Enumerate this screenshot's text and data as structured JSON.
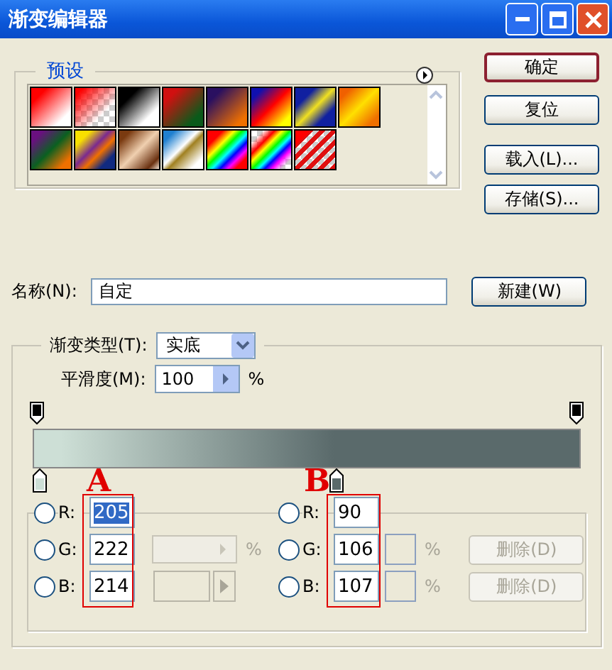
{
  "window": {
    "title": "渐变编辑器"
  },
  "presets": {
    "label": "预设"
  },
  "buttons": [
    {
      "label": "确定",
      "default": true
    },
    {
      "label": "复位",
      "default": false
    },
    {
      "label": "载入(L)...",
      "default": false
    },
    {
      "label": "存储(S)...",
      "default": false
    }
  ],
  "name": {
    "label": "名称(N):",
    "value": "自定",
    "button": "新建(W)"
  },
  "gradient_type": {
    "label": "渐变类型(T):",
    "value": "实底"
  },
  "smoothness": {
    "label": "平滑度(M):",
    "value": "100",
    "unit": "%"
  },
  "color_stops": [
    {
      "color": "#cddfd6"
    },
    {
      "color": "#5a6a6b"
    }
  ],
  "annotations": [
    "A",
    "B"
  ],
  "stop_a": {
    "channels": [
      {
        "label": "R:",
        "value": "205",
        "selected": true,
        "checked": false
      },
      {
        "label": "G:",
        "value": "222",
        "selected": false,
        "checked": false
      },
      {
        "label": "B:",
        "value": "214",
        "selected": false,
        "checked": false
      }
    ],
    "unit": "%"
  },
  "stop_b": {
    "channels": [
      {
        "label": "R:",
        "value": "90",
        "selected": false,
        "checked": false
      },
      {
        "label": "G:",
        "value": "106",
        "selected": false,
        "checked": false
      },
      {
        "label": "B:",
        "value": "107",
        "selected": false,
        "checked": false
      }
    ],
    "units": [
      "%",
      "%"
    ]
  },
  "delete_buttons": [
    {
      "label": "删除(D)",
      "disabled": true
    },
    {
      "label": "删除(D)",
      "disabled": true
    }
  ]
}
